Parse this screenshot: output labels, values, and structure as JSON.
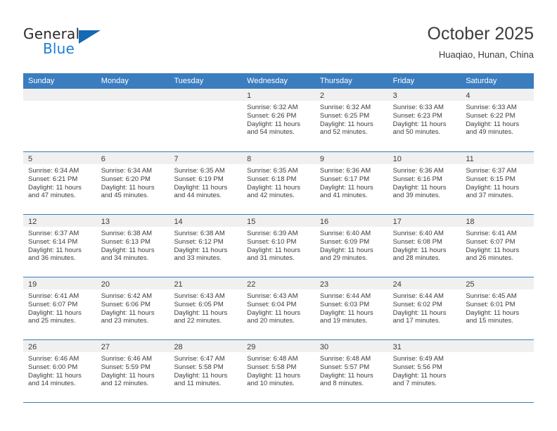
{
  "brand": {
    "name_top": "General",
    "name_bottom": "Blue",
    "triangle_color": "#1569b4",
    "blue_text_color": "#1c7fd6"
  },
  "header": {
    "title": "October 2025",
    "subtitle": "Huaqiao, Hunan, China"
  },
  "theme": {
    "header_blue": "#3b7dbf",
    "day_bar_gray": "#f0f0f0",
    "text": "#3c3c3c"
  },
  "calendar": {
    "weekdays": [
      "Sunday",
      "Monday",
      "Tuesday",
      "Wednesday",
      "Thursday",
      "Friday",
      "Saturday"
    ],
    "weeks": [
      [
        {
          "day": "",
          "sunrise": "",
          "sunset": "",
          "daylight_line1": "",
          "daylight_line2": "",
          "empty": true
        },
        {
          "day": "",
          "sunrise": "",
          "sunset": "",
          "daylight_line1": "",
          "daylight_line2": "",
          "empty": true
        },
        {
          "day": "",
          "sunrise": "",
          "sunset": "",
          "daylight_line1": "",
          "daylight_line2": "",
          "empty": true
        },
        {
          "day": "1",
          "sunrise": "Sunrise: 6:32 AM",
          "sunset": "Sunset: 6:26 PM",
          "daylight_line1": "Daylight: 11 hours",
          "daylight_line2": "and 54 minutes.",
          "empty": false
        },
        {
          "day": "2",
          "sunrise": "Sunrise: 6:32 AM",
          "sunset": "Sunset: 6:25 PM",
          "daylight_line1": "Daylight: 11 hours",
          "daylight_line2": "and 52 minutes.",
          "empty": false
        },
        {
          "day": "3",
          "sunrise": "Sunrise: 6:33 AM",
          "sunset": "Sunset: 6:23 PM",
          "daylight_line1": "Daylight: 11 hours",
          "daylight_line2": "and 50 minutes.",
          "empty": false
        },
        {
          "day": "4",
          "sunrise": "Sunrise: 6:33 AM",
          "sunset": "Sunset: 6:22 PM",
          "daylight_line1": "Daylight: 11 hours",
          "daylight_line2": "and 49 minutes.",
          "empty": false
        }
      ],
      [
        {
          "day": "5",
          "sunrise": "Sunrise: 6:34 AM",
          "sunset": "Sunset: 6:21 PM",
          "daylight_line1": "Daylight: 11 hours",
          "daylight_line2": "and 47 minutes.",
          "empty": false
        },
        {
          "day": "6",
          "sunrise": "Sunrise: 6:34 AM",
          "sunset": "Sunset: 6:20 PM",
          "daylight_line1": "Daylight: 11 hours",
          "daylight_line2": "and 45 minutes.",
          "empty": false
        },
        {
          "day": "7",
          "sunrise": "Sunrise: 6:35 AM",
          "sunset": "Sunset: 6:19 PM",
          "daylight_line1": "Daylight: 11 hours",
          "daylight_line2": "and 44 minutes.",
          "empty": false
        },
        {
          "day": "8",
          "sunrise": "Sunrise: 6:35 AM",
          "sunset": "Sunset: 6:18 PM",
          "daylight_line1": "Daylight: 11 hours",
          "daylight_line2": "and 42 minutes.",
          "empty": false
        },
        {
          "day": "9",
          "sunrise": "Sunrise: 6:36 AM",
          "sunset": "Sunset: 6:17 PM",
          "daylight_line1": "Daylight: 11 hours",
          "daylight_line2": "and 41 minutes.",
          "empty": false
        },
        {
          "day": "10",
          "sunrise": "Sunrise: 6:36 AM",
          "sunset": "Sunset: 6:16 PM",
          "daylight_line1": "Daylight: 11 hours",
          "daylight_line2": "and 39 minutes.",
          "empty": false
        },
        {
          "day": "11",
          "sunrise": "Sunrise: 6:37 AM",
          "sunset": "Sunset: 6:15 PM",
          "daylight_line1": "Daylight: 11 hours",
          "daylight_line2": "and 37 minutes.",
          "empty": false
        }
      ],
      [
        {
          "day": "12",
          "sunrise": "Sunrise: 6:37 AM",
          "sunset": "Sunset: 6:14 PM",
          "daylight_line1": "Daylight: 11 hours",
          "daylight_line2": "and 36 minutes.",
          "empty": false
        },
        {
          "day": "13",
          "sunrise": "Sunrise: 6:38 AM",
          "sunset": "Sunset: 6:13 PM",
          "daylight_line1": "Daylight: 11 hours",
          "daylight_line2": "and 34 minutes.",
          "empty": false
        },
        {
          "day": "14",
          "sunrise": "Sunrise: 6:38 AM",
          "sunset": "Sunset: 6:12 PM",
          "daylight_line1": "Daylight: 11 hours",
          "daylight_line2": "and 33 minutes.",
          "empty": false
        },
        {
          "day": "15",
          "sunrise": "Sunrise: 6:39 AM",
          "sunset": "Sunset: 6:10 PM",
          "daylight_line1": "Daylight: 11 hours",
          "daylight_line2": "and 31 minutes.",
          "empty": false
        },
        {
          "day": "16",
          "sunrise": "Sunrise: 6:40 AM",
          "sunset": "Sunset: 6:09 PM",
          "daylight_line1": "Daylight: 11 hours",
          "daylight_line2": "and 29 minutes.",
          "empty": false
        },
        {
          "day": "17",
          "sunrise": "Sunrise: 6:40 AM",
          "sunset": "Sunset: 6:08 PM",
          "daylight_line1": "Daylight: 11 hours",
          "daylight_line2": "and 28 minutes.",
          "empty": false
        },
        {
          "day": "18",
          "sunrise": "Sunrise: 6:41 AM",
          "sunset": "Sunset: 6:07 PM",
          "daylight_line1": "Daylight: 11 hours",
          "daylight_line2": "and 26 minutes.",
          "empty": false
        }
      ],
      [
        {
          "day": "19",
          "sunrise": "Sunrise: 6:41 AM",
          "sunset": "Sunset: 6:07 PM",
          "daylight_line1": "Daylight: 11 hours",
          "daylight_line2": "and 25 minutes.",
          "empty": false
        },
        {
          "day": "20",
          "sunrise": "Sunrise: 6:42 AM",
          "sunset": "Sunset: 6:06 PM",
          "daylight_line1": "Daylight: 11 hours",
          "daylight_line2": "and 23 minutes.",
          "empty": false
        },
        {
          "day": "21",
          "sunrise": "Sunrise: 6:43 AM",
          "sunset": "Sunset: 6:05 PM",
          "daylight_line1": "Daylight: 11 hours",
          "daylight_line2": "and 22 minutes.",
          "empty": false
        },
        {
          "day": "22",
          "sunrise": "Sunrise: 6:43 AM",
          "sunset": "Sunset: 6:04 PM",
          "daylight_line1": "Daylight: 11 hours",
          "daylight_line2": "and 20 minutes.",
          "empty": false
        },
        {
          "day": "23",
          "sunrise": "Sunrise: 6:44 AM",
          "sunset": "Sunset: 6:03 PM",
          "daylight_line1": "Daylight: 11 hours",
          "daylight_line2": "and 19 minutes.",
          "empty": false
        },
        {
          "day": "24",
          "sunrise": "Sunrise: 6:44 AM",
          "sunset": "Sunset: 6:02 PM",
          "daylight_line1": "Daylight: 11 hours",
          "daylight_line2": "and 17 minutes.",
          "empty": false
        },
        {
          "day": "25",
          "sunrise": "Sunrise: 6:45 AM",
          "sunset": "Sunset: 6:01 PM",
          "daylight_line1": "Daylight: 11 hours",
          "daylight_line2": "and 15 minutes.",
          "empty": false
        }
      ],
      [
        {
          "day": "26",
          "sunrise": "Sunrise: 6:46 AM",
          "sunset": "Sunset: 6:00 PM",
          "daylight_line1": "Daylight: 11 hours",
          "daylight_line2": "and 14 minutes.",
          "empty": false
        },
        {
          "day": "27",
          "sunrise": "Sunrise: 6:46 AM",
          "sunset": "Sunset: 5:59 PM",
          "daylight_line1": "Daylight: 11 hours",
          "daylight_line2": "and 12 minutes.",
          "empty": false
        },
        {
          "day": "28",
          "sunrise": "Sunrise: 6:47 AM",
          "sunset": "Sunset: 5:58 PM",
          "daylight_line1": "Daylight: 11 hours",
          "daylight_line2": "and 11 minutes.",
          "empty": false
        },
        {
          "day": "29",
          "sunrise": "Sunrise: 6:48 AM",
          "sunset": "Sunset: 5:58 PM",
          "daylight_line1": "Daylight: 11 hours",
          "daylight_line2": "and 10 minutes.",
          "empty": false
        },
        {
          "day": "30",
          "sunrise": "Sunrise: 6:48 AM",
          "sunset": "Sunset: 5:57 PM",
          "daylight_line1": "Daylight: 11 hours",
          "daylight_line2": "and 8 minutes.",
          "empty": false
        },
        {
          "day": "31",
          "sunrise": "Sunrise: 6:49 AM",
          "sunset": "Sunset: 5:56 PM",
          "daylight_line1": "Daylight: 11 hours",
          "daylight_line2": "and 7 minutes.",
          "empty": false
        },
        {
          "day": "",
          "sunrise": "",
          "sunset": "",
          "daylight_line1": "",
          "daylight_line2": "",
          "empty": true
        }
      ]
    ]
  }
}
